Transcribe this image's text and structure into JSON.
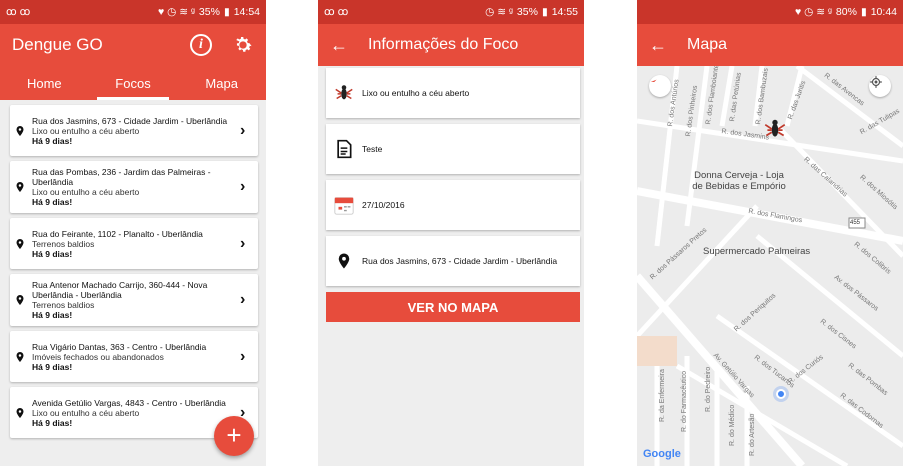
{
  "screen1": {
    "status": {
      "left": "ꝏ ꝏ",
      "icons": "♥ ◷ ≋ ᵍ",
      "battery": "35%",
      "time": "14:54"
    },
    "title": "Dengue GO",
    "tabs": [
      "Home",
      "Focos",
      "Mapa"
    ],
    "items": [
      {
        "address": "Rua dos Jasmins, 673 - Cidade Jardim - Uberlândia",
        "type": "Lixo ou entulho a céu aberto",
        "age": "Há 9 dias!"
      },
      {
        "address": "Rua das Pombas, 236 - Jardim das Palmeiras - Uberlândia",
        "type": "Lixo ou entulho a céu aberto",
        "age": "Há 9 dias!"
      },
      {
        "address": "Rua do Feirante, 1102 - Planalto - Uberlândia",
        "type": "Terrenos baldios",
        "age": "Há 9 dias!"
      },
      {
        "address": "Rua Antenor Machado Carrijo, 360-444 - Nova Uberlândia - Uberlândia",
        "type": "Terrenos baldios",
        "age": "Há 9 dias!"
      },
      {
        "address": "Rua Vigário Dantas, 363 - Centro - Uberlândia",
        "type": "Imóveis fechados ou abandonados",
        "age": "Há 9 dias!"
      },
      {
        "address": "Avenida Getúlio Vargas, 4843 - Centro - Uberlândia",
        "type": "Lixo ou entulho a céu aberto",
        "age": "Há 9 dias!"
      }
    ],
    "fab": "+"
  },
  "screen2": {
    "status": {
      "left": "ꝏ ꝏ",
      "icons": "◷ ≋ ᵍ",
      "battery": "35%",
      "time": "14:55"
    },
    "title": "Informações do Foco",
    "type": "Lixo ou entulho a céu aberto",
    "description": "Teste",
    "date": "27/10/2016",
    "address": "Rua dos Jasmins, 673 - Cidade Jardim - Uberlândia",
    "button": "VER NO MAPA"
  },
  "screen3": {
    "status": {
      "icons": "♥ ◷ ≋ ᵍ",
      "battery": "80%",
      "time": "10:44"
    },
    "title": "Mapa",
    "streets": [
      "R. dos Flamboiantes",
      "R. das Petúnias",
      "R. dos Bambuzais",
      "R. das Juritis",
      "R. dos Antúrios",
      "R. dos Pinheiros",
      "R. dos Jasmins",
      "R. das Avencas",
      "R. das Tulipas",
      "R. das Calandrias",
      "R. dos Miosótis",
      "R. dos Flamingos",
      "R. dos Pássaros Pretos",
      "R. dos Colibris",
      "Av. dos Pássaros",
      "R. dos Periquitos",
      "R. dos Cisnes",
      "Av. Getúlio Vargas",
      "R. dos Tucanos",
      "R. dos Curiós",
      "R. das Pombas",
      "R. das Codornas",
      "R. da Enfermeira",
      "R. do Farmacêutico",
      "R. do Pedreiro",
      "R. do Médico",
      "R. do Artesão"
    ],
    "poi1": "Donna Cerveja - Loja de Bebidas e Empório",
    "poi2": "Supermercado Palmeiras",
    "shield": "455",
    "google": "Google"
  },
  "colors": {
    "primary": "#e74c3c",
    "status": "#c9352a",
    "background": "#eeeeee"
  }
}
